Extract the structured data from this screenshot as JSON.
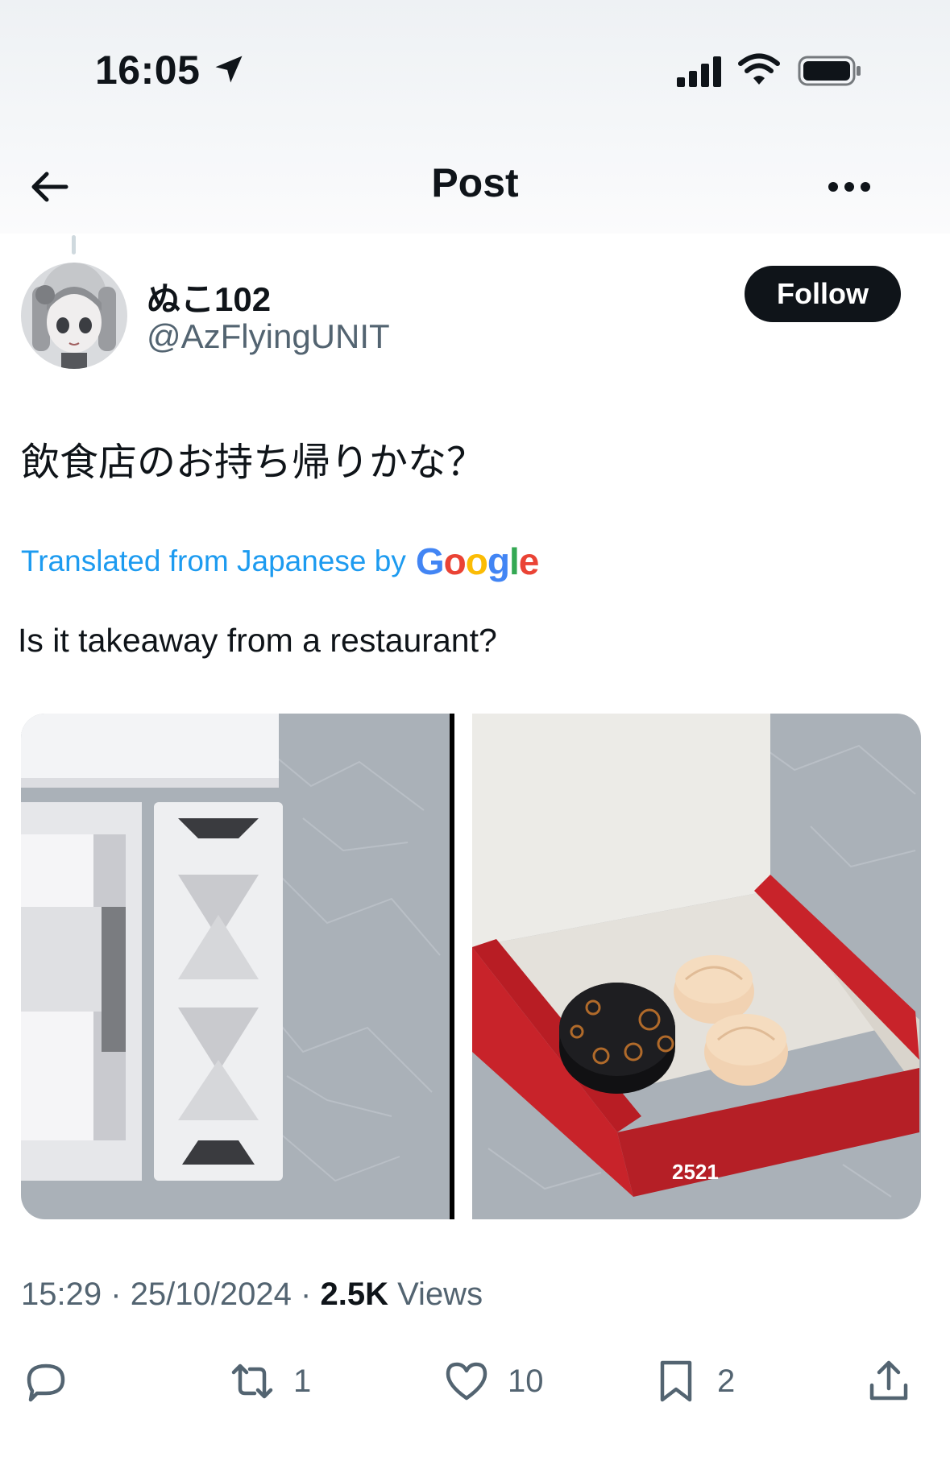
{
  "status_bar": {
    "time": "16:05"
  },
  "nav": {
    "title": "Post"
  },
  "author": {
    "name": "ぬこ102",
    "handle": "@AzFlyingUNIT",
    "follow_label": "Follow"
  },
  "post": {
    "original_text": "飲食店のお持ち帰りかな？",
    "translated_label": "Translated from Japanese by",
    "translator": "Google",
    "translated_text": "Is it takeaway from a restaurant?"
  },
  "media": {
    "box_label_number": "2521"
  },
  "meta": {
    "time": "15:29",
    "date": "25/10/2024",
    "views_count": "2.5K",
    "views_label": "Views",
    "separator": "·"
  },
  "actions": {
    "replies": "",
    "reposts": "1",
    "likes": "10",
    "bookmarks": "2"
  },
  "colors": {
    "accent": "#1d9bf0",
    "text": "#0f1419",
    "muted": "#536471"
  }
}
